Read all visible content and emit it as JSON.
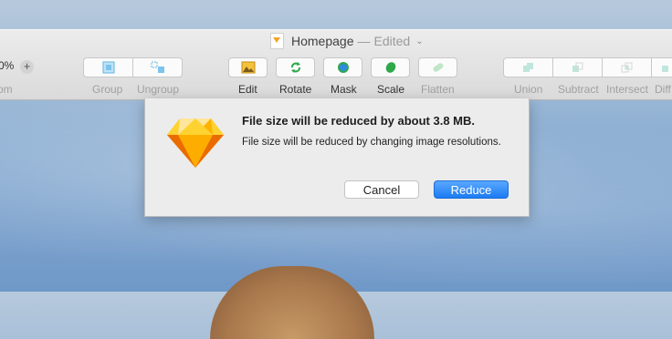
{
  "window": {
    "title": "Homepage",
    "separator": "—",
    "status": "Edited",
    "zoom_value": "0%",
    "zoom_label": "om"
  },
  "toolbar": {
    "group": "Group",
    "ungroup": "Ungroup",
    "edit": "Edit",
    "rotate": "Rotate",
    "mask": "Mask",
    "scale": "Scale",
    "flatten": "Flatten",
    "union": "Union",
    "subtract": "Subtract",
    "intersect": "Intersect",
    "difference": "Diff"
  },
  "dialog": {
    "title": "File size will be reduced by about 3.8 MB.",
    "message": "File size will be reduced by changing image resolutions.",
    "cancel_label": "Cancel",
    "reduce_label": "Reduce"
  },
  "colors": {
    "accent": "#1b7bf3",
    "sketch_orange": "#f7a21b"
  }
}
